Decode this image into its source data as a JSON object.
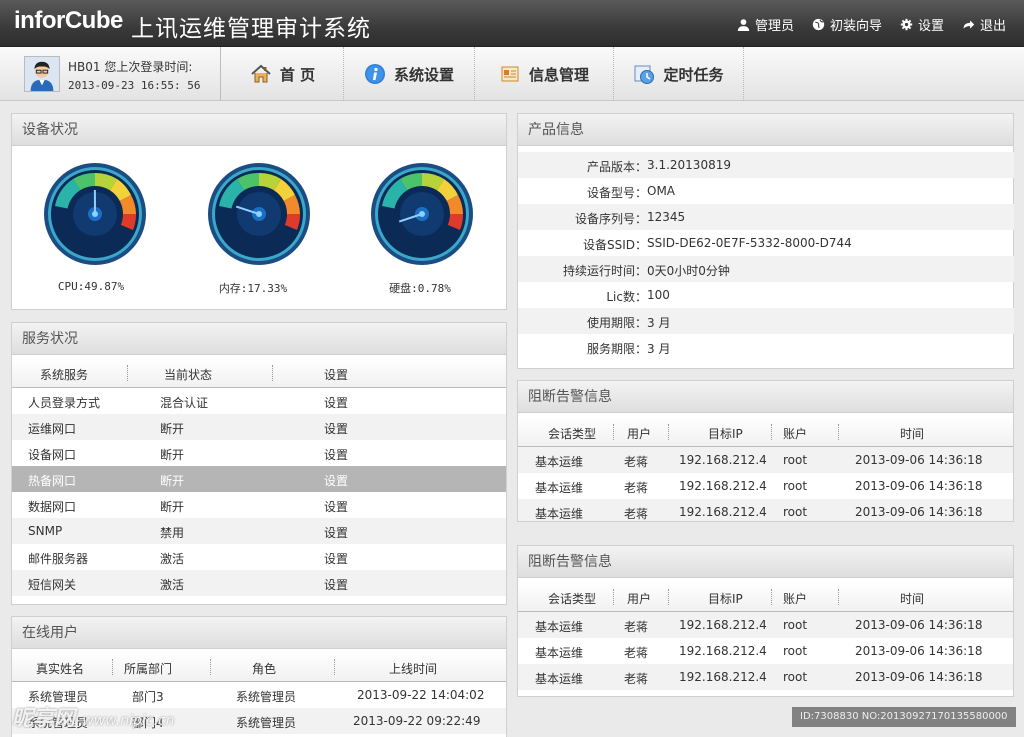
{
  "header": {
    "logo": "inforCube",
    "title": "上讯运维管理审计系统",
    "links": [
      "管理员",
      "初装向导",
      "设置",
      "退出"
    ]
  },
  "user": {
    "line1": "HB01 您上次登录时间:",
    "line2": "2013-09-23 16:55: 56"
  },
  "nav": {
    "tabs": [
      "首 页",
      "系统设置",
      "信息管理",
      "定时任务"
    ]
  },
  "device": {
    "title": "设备状况",
    "gauges": [
      {
        "label": "CPU:49.87%",
        "value": 49.87
      },
      {
        "label": "内存:17.33%",
        "value": 17.33
      },
      {
        "label": "硬盘:0.78%",
        "value": 0.78
      }
    ]
  },
  "services": {
    "title": "服务状况",
    "columns": [
      "系统服务",
      "当前状态",
      "设置"
    ],
    "rows": [
      {
        "name": "人员登录方式",
        "status": "混合认证",
        "action": "设置"
      },
      {
        "name": "运维网口",
        "status": "断开",
        "action": "设置"
      },
      {
        "name": "设备网口",
        "status": "断开",
        "action": "设置"
      },
      {
        "name": "热备网口",
        "status": "断开",
        "action": "设置"
      },
      {
        "name": "数据网口",
        "status": "断开",
        "action": "设置"
      },
      {
        "name": "SNMP",
        "status": "禁用",
        "action": "设置"
      },
      {
        "name": "邮件服务器",
        "status": "激活",
        "action": "设置"
      },
      {
        "name": "短信网关",
        "status": "激活",
        "action": "设置"
      }
    ]
  },
  "online": {
    "title": "在线用户",
    "columns": [
      "真实姓名",
      "所属部门",
      "角色",
      "上线时间"
    ],
    "rows": [
      {
        "name": "系统管理员",
        "dept": "部门3",
        "role": "系统管理员",
        "time": "2013-09-22 14:04:02"
      },
      {
        "name": "系统管理员",
        "dept": "部门4",
        "role": "系统管理员",
        "time": "2013-09-22 09:22:49"
      }
    ]
  },
  "product": {
    "title": "产品信息",
    "rows": [
      {
        "label": "产品版本：",
        "value": "3.1.20130819"
      },
      {
        "label": "设备型号：",
        "value": "OMA"
      },
      {
        "label": "设备序列号：",
        "value": "12345"
      },
      {
        "label": "设备SSID：",
        "value": "SSID-DE62-0E7F-5332-8000-D744"
      },
      {
        "label": "持续运行时间：",
        "value": "0天0小时0分钟"
      },
      {
        "label": "Lic数：",
        "value": "100"
      },
      {
        "label": "使用期限：",
        "value": "3 月"
      },
      {
        "label": "服务期限：",
        "value": "3 月"
      }
    ]
  },
  "alerts1": {
    "title": "阻断告警信息",
    "columns": [
      "会话类型",
      "用户",
      "目标IP",
      "账户",
      "时间"
    ],
    "rows": [
      {
        "type": "基本运维",
        "user": "老蒋",
        "ip": "192.168.212.4",
        "account": "root",
        "time": "2013-09-06 14:36:18"
      },
      {
        "type": "基本运维",
        "user": "老蒋",
        "ip": "192.168.212.4",
        "account": "root",
        "time": "2013-09-06 14:36:18"
      },
      {
        "type": "基本运维",
        "user": "老蒋",
        "ip": "192.168.212.4",
        "account": "root",
        "time": "2013-09-06 14:36:18"
      }
    ]
  },
  "alerts2": {
    "title": "阻断告警信息",
    "columns": [
      "会话类型",
      "用户",
      "目标IP",
      "账户",
      "时间"
    ],
    "rows": [
      {
        "type": "基本运维",
        "user": "老蒋",
        "ip": "192.168.212.4",
        "account": "root",
        "time": "2013-09-06 14:36:18"
      },
      {
        "type": "基本运维",
        "user": "老蒋",
        "ip": "192.168.212.4",
        "account": "root",
        "time": "2013-09-06 14:36:18"
      },
      {
        "type": "基本运维",
        "user": "老蒋",
        "ip": "192.168.212.4",
        "account": "root",
        "time": "2013-09-06 14:36:18"
      }
    ]
  },
  "footer": {
    "watermark": "昵享网",
    "watermark_site": "www.nipic.cn",
    "id": "ID:7308830 NO:20130927170135580000"
  }
}
